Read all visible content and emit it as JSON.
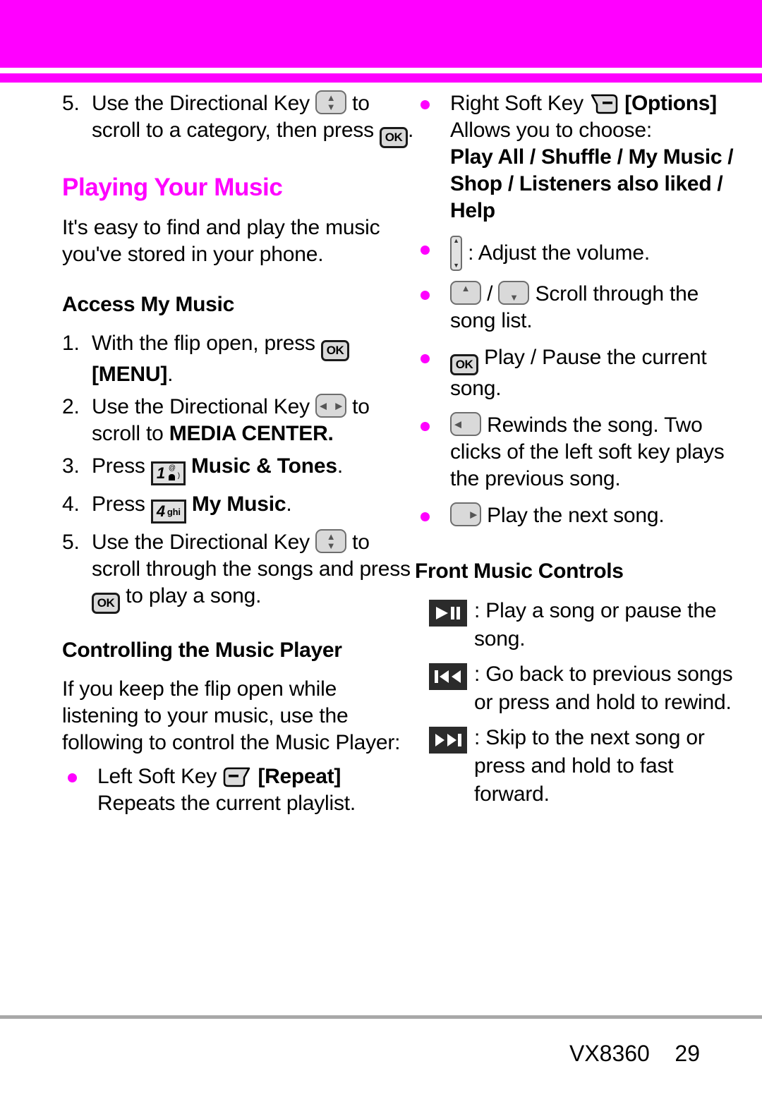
{
  "page": {
    "header_color": "#ff00ff",
    "accent_color": "#ff00ff",
    "footer_model": "VX8360",
    "footer_page": "29",
    "footer_line": "VX8360    29"
  },
  "left_column": {
    "continued_step": {
      "num": "5.",
      "text_a": "Use the Directional Key",
      "icon_a": "directional-key-updown-icon",
      "text_b": "to scroll to a category, then press",
      "icon_b": "ok-key-icon",
      "text_c": "."
    },
    "section_title": "Playing Your Music",
    "intro": "It's easy to find and play the music you've stored in your phone.",
    "access_heading": "Access My Music",
    "access_steps": [
      {
        "num": "1.",
        "text_a": "With the flip open, press",
        "icon": "ok-key-icon",
        "bold_b": "[MENU]",
        "text_c": "."
      },
      {
        "num": "2.",
        "text_a": "Use the Directional Key",
        "icon": "directional-key-leftright-icon",
        "text_b": "to scroll to",
        "bold_b": "MEDIA CENTER.",
        "text_c": ""
      },
      {
        "num": "3.",
        "text_a": "Press",
        "icon": "key-1-voicemail-icon",
        "key_digit": "1",
        "bold_b": "Music & Tones",
        "text_c": "."
      },
      {
        "num": "4.",
        "text_a": "Press",
        "icon": "key-4-ghi-icon",
        "key_digit": "4",
        "key_letters": "ghi",
        "bold_b": "My Music",
        "text_c": "."
      },
      {
        "num": "5.",
        "text_a": "Use the Directional Key",
        "icon": "directional-key-updown-icon",
        "text_b": "to scroll through the songs and press",
        "icon_b": "ok-key-icon",
        "text_c": "to play a song."
      }
    ],
    "controlling_heading": "Controlling the Music Player",
    "controlling_intro": "If you keep the flip open while listening to your music, use the following to control the Music Player:",
    "left_soft_key": {
      "label": "Left Soft Key",
      "icon": "left-soft-key-icon",
      "bracket": "[Repeat]",
      "description": "Repeats the current playlist."
    }
  },
  "right_column": {
    "right_soft_key": {
      "label": "Right Soft Key",
      "icon": "right-soft-key-icon",
      "bracket": "[Options]",
      "description": "Allows you to choose:",
      "options_line1": "Play All / Shuffle / My Music /",
      "options_line2": "Shop / Listeners also liked /",
      "options_line3": "Help"
    },
    "bullets": [
      {
        "icon": "volume-side-key-icon",
        "text": ": Adjust the volume."
      },
      {
        "icon_a": "directional-key-up-icon",
        "separator": "/",
        "icon_b": "directional-key-down-icon",
        "text": "Scroll through the song list."
      },
      {
        "icon": "ok-key-icon",
        "text": "Play / Pause the current song."
      },
      {
        "icon": "directional-key-left-icon",
        "text": "Rewinds the song. Two clicks of the left soft key plays the previous song."
      },
      {
        "icon": "directional-key-right-icon",
        "text": "Play the next song."
      }
    ],
    "front_controls_heading": "Front Music Controls",
    "front_controls": [
      {
        "icon": "play-pause-button-icon",
        "text": ": Play a song or pause the song."
      },
      {
        "icon": "previous-track-button-icon",
        "text": ": Go back to previous songs or press and hold to rewind."
      },
      {
        "icon": "next-track-button-icon",
        "text": ": Skip to the next song or press and hold to fast forward."
      }
    ]
  }
}
